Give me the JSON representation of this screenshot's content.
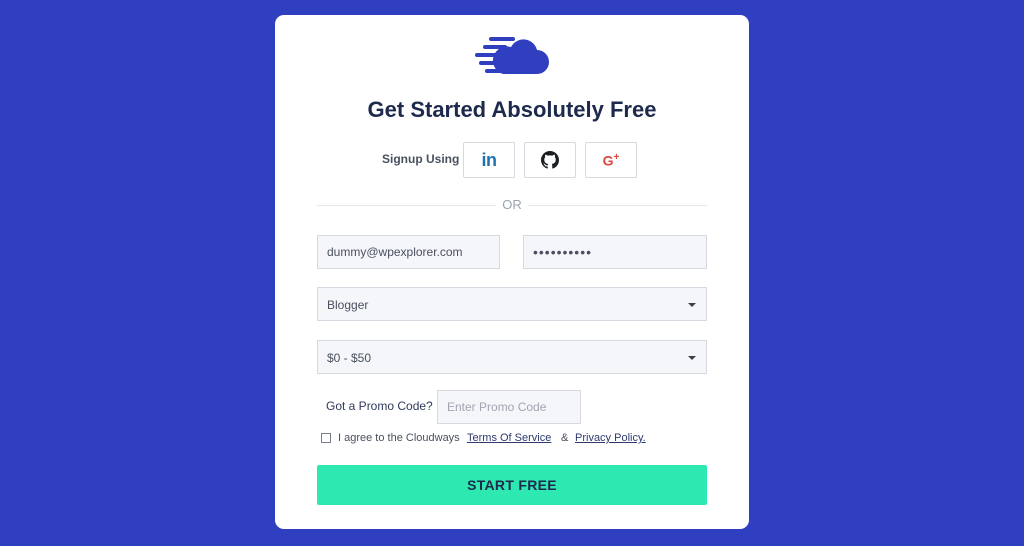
{
  "colors": {
    "background": "#2f3fbf",
    "brand_blue": "#2f3fbf",
    "cta_green": "#2de8b0",
    "linkedin": "#1f72b0",
    "google": "#d8483e"
  },
  "logo": {
    "icon": "cloudways-cloud-logo"
  },
  "title": "Get Started Absolutely Free",
  "signup": {
    "label": "Signup Using",
    "providers": [
      {
        "name": "linkedin",
        "icon": "linkedin-icon",
        "glyph": "in"
      },
      {
        "name": "github",
        "icon": "github-icon"
      },
      {
        "name": "google",
        "icon": "google-plus-icon",
        "glyph": "G",
        "glyph_sup": "+"
      }
    ]
  },
  "divider_text": "OR",
  "form": {
    "email_value": "dummy@wpexplorer.com",
    "password_value": "••••••••••",
    "role_selected": "Blogger",
    "budget_selected": "$0 - $50",
    "promo_label": "Got a Promo Code?",
    "promo_placeholder": "Enter Promo Code",
    "agree_text": "I agree to the Cloudways",
    "terms_link": "Terms Of Service",
    "amp": "&",
    "privacy_link": "Privacy Policy.",
    "submit_label": "START FREE"
  }
}
